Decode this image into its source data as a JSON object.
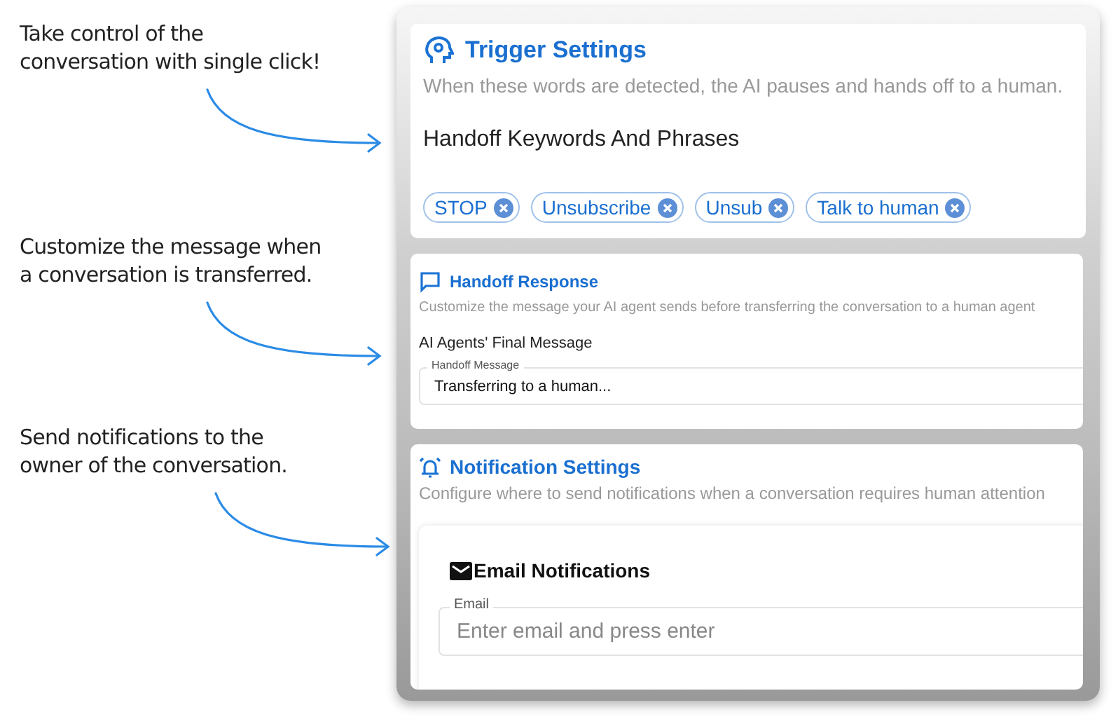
{
  "annotations": [
    {
      "lines": [
        "Take control of the",
        "conversation with single click!"
      ]
    },
    {
      "lines": [
        "Customize the message when",
        "a conversation is transferred."
      ]
    },
    {
      "lines": [
        "Send notifications to the",
        "owner of the conversation."
      ]
    }
  ],
  "trigger_settings": {
    "title": "Trigger Settings",
    "description": "When these words are detected, the AI pauses and hands off to a human.",
    "label": "Handoff Keywords And Phrases",
    "keywords": [
      "STOP",
      "Unsubscribe",
      "Unsub",
      "Talk to human"
    ]
  },
  "handoff_response": {
    "title": "Handoff Response",
    "description": "Customize the message your AI agent sends before transferring the conversation to a human agent",
    "label": "AI Agents' Final Message",
    "field": {
      "label": "Handoff Message",
      "value": "Transferring to a human..."
    }
  },
  "notification_settings": {
    "title": "Notification Settings",
    "description": "Configure where to send notifications when a conversation requires human attention",
    "email": {
      "title": "Email Notifications",
      "field": {
        "label": "Email",
        "placeholder": "Enter email and press enter"
      }
    }
  }
}
